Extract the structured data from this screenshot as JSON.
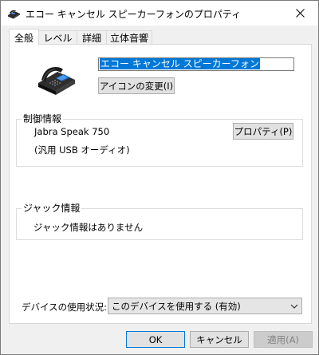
{
  "window": {
    "title": "エコー キャンセル スピーカーフォンのプロパティ",
    "close_icon": "close-icon",
    "title_icon": "speakerphone-icon"
  },
  "tabs": [
    {
      "label": "全般",
      "active": true
    },
    {
      "label": "レベル",
      "active": false
    },
    {
      "label": "詳細",
      "active": false
    },
    {
      "label": "立体音響",
      "active": false
    }
  ],
  "general": {
    "device_name": "エコー キャンセル スピーカーフォン",
    "change_icon_button": "アイコンの変更(I)",
    "controller_group": {
      "label": "制御情報",
      "device": "Jabra Speak 750",
      "driver": "(汎用 USB オーディオ)",
      "properties_button": "プロパティ(P)"
    },
    "jack_group": {
      "label": "ジャック情報",
      "info": "ジャック情報はありません"
    },
    "usage": {
      "label": "デバイスの使用状況:",
      "selected": "このデバイスを使用する (有効)"
    }
  },
  "footer": {
    "ok": "OK",
    "cancel": "キャンセル",
    "apply": "適用(A)"
  }
}
